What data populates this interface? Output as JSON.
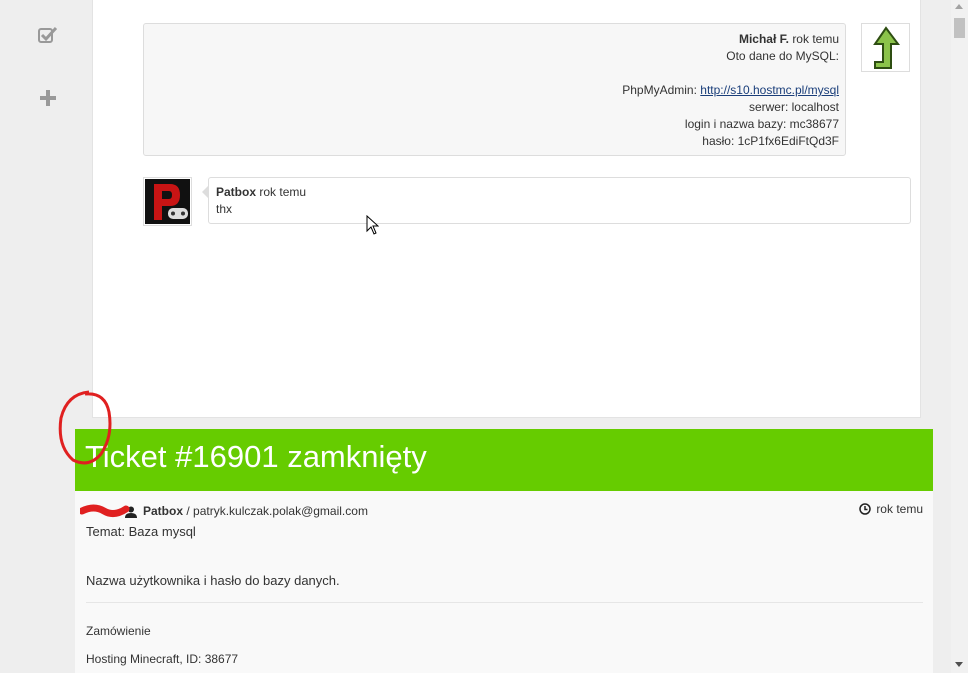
{
  "sidebar": {
    "items": [
      {
        "icon": "checkbox-check-icon"
      },
      {
        "icon": "plus-icon"
      }
    ]
  },
  "messages": [
    {
      "author": "Michał F.",
      "time": "rok temu",
      "lines": [
        "Oto dane do MySQL:",
        "",
        "PhpMyAdmin: ",
        "serwer: localhost",
        "login i nazwa bazy: mc38677",
        "hasło: 1cP1fx6EdiFtQd3F"
      ],
      "link": "http://s10.hostmc.pl/mysql",
      "avatar_icon": "green-up-arrow-icon"
    },
    {
      "author": "Patbox",
      "time": "rok temu",
      "text": "thx",
      "avatar_icon": "patbox-logo-icon"
    }
  ],
  "closed": {
    "title": "Ticket #16901 zamknięty"
  },
  "ticket": {
    "author": "Patbox",
    "separator": " / ",
    "email": "patryk.kulczak.polak@gmail.com",
    "time": "rok temu",
    "subject": "Temat: Baza mysql",
    "description": "Nazwa użytkownika i hasło do bazy danych.",
    "section_label": "Zamówienie",
    "hosting": "Hosting Minecraft, ID: 38677"
  },
  "colors": {
    "banner": "#66cc00",
    "link": "#1a3e7a",
    "annotation": "#e02020"
  }
}
